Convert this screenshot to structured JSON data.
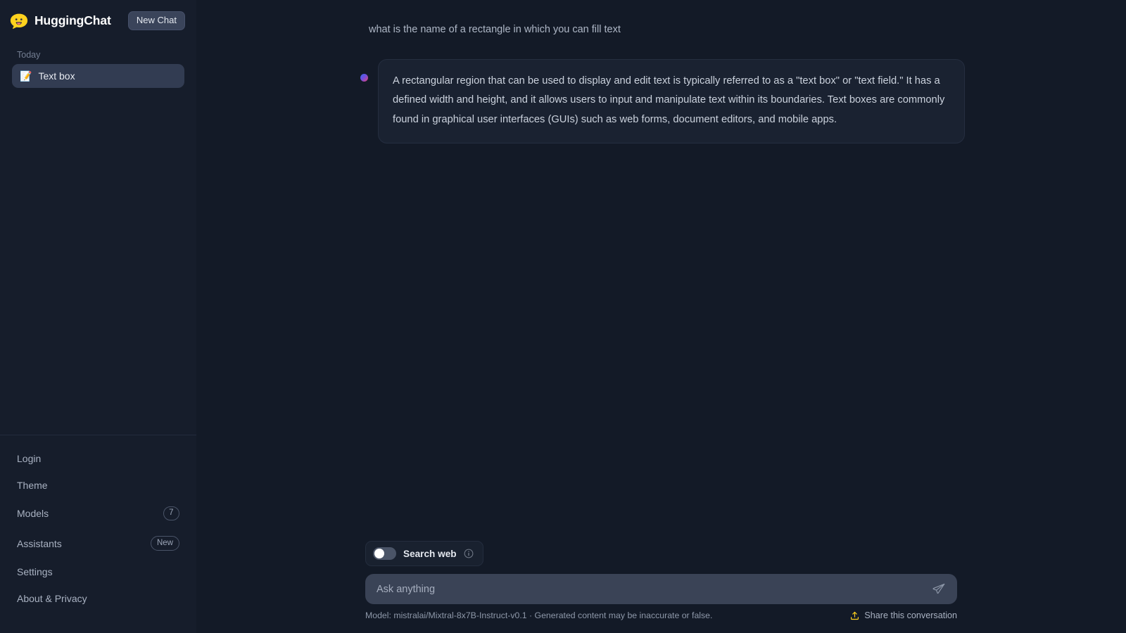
{
  "app": {
    "brand": "HuggingChat",
    "logo_icon": "speech-bubble-smiley-icon",
    "accent_yellow": "#FFD21E",
    "sidebar_bg": "#161D2B",
    "main_bg": "#131A27"
  },
  "sidebar": {
    "new_chat_label": "New Chat",
    "groups": [
      {
        "label": "Today",
        "items": [
          {
            "emoji": "📝",
            "title": "Text box",
            "active": true
          }
        ]
      }
    ],
    "menu": [
      {
        "label": "Login",
        "badge": null,
        "badge_kind": null
      },
      {
        "label": "Theme",
        "badge": null,
        "badge_kind": null
      },
      {
        "label": "Models",
        "badge": "7",
        "badge_kind": "count"
      },
      {
        "label": "Assistants",
        "badge": "New",
        "badge_kind": "pill"
      },
      {
        "label": "Settings",
        "badge": null,
        "badge_kind": null
      },
      {
        "label": "About & Privacy",
        "badge": null,
        "badge_kind": null
      }
    ]
  },
  "conversation": {
    "messages": [
      {
        "role": "user",
        "text": "what is the name of a rectangle in which you can fill text"
      },
      {
        "role": "assistant",
        "avatar": "model-gradient-dot",
        "text": "A rectangular region that can be used to display and edit text is typically referred to as a \"text box\" or \"text field.\" It has a defined width and height, and it allows users to input and manipulate text within its boundaries. Text boxes are commonly found in graphical user interfaces (GUIs) such as web forms, document editors, and mobile apps."
      }
    ]
  },
  "composer": {
    "search_web_label": "Search web",
    "search_web_enabled": false,
    "search_web_info_icon": "info-circle-icon",
    "input_value": "",
    "input_placeholder": "Ask anything",
    "send_icon": "paper-plane-icon"
  },
  "footer": {
    "model_note": "Model: mistralai/Mixtral-8x7B-Instruct-v0.1 · Generated content may be inaccurate or false.",
    "share_label": "Share this conversation",
    "share_icon": "upload-arrow-icon"
  }
}
